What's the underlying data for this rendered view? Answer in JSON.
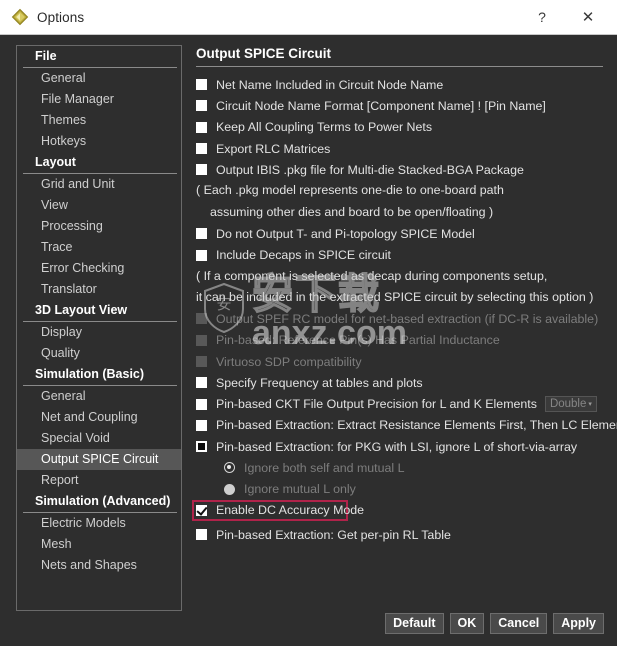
{
  "window": {
    "title": "Options",
    "icon": "diamond-logo-icon",
    "help_label": "?",
    "close_label": "✕"
  },
  "sidebar": {
    "groups": [
      {
        "header": "File",
        "items": [
          "General",
          "File Manager",
          "Themes",
          "Hotkeys"
        ]
      },
      {
        "header": "Layout",
        "items": [
          "Grid and Unit",
          "View",
          "Processing",
          "Trace",
          "Error Checking",
          "Translator"
        ]
      },
      {
        "header": "3D Layout View",
        "items": [
          "Display",
          "Quality"
        ]
      },
      {
        "header": "Simulation (Basic)",
        "items": [
          "General",
          "Net and Coupling",
          "Special Void",
          "Output SPICE Circuit",
          "Report"
        ]
      },
      {
        "header": "Simulation (Advanced)",
        "items": [
          "Electric Models",
          "Mesh",
          "Nets and Shapes"
        ]
      }
    ],
    "selected_item": "Output SPICE Circuit"
  },
  "main": {
    "title": "Output SPICE Circuit",
    "options": [
      {
        "label": "Net Name Included in Circuit Node Name",
        "checked": false,
        "enabled": true
      },
      {
        "label": "Circuit Node Name Format [Component Name] ! [Pin Name]",
        "checked": false,
        "enabled": true
      },
      {
        "label": "Keep All Coupling Terms to Power Nets",
        "checked": false,
        "enabled": true
      },
      {
        "label": "Export RLC Matrices",
        "checked": false,
        "enabled": true
      },
      {
        "label": "Output IBIS .pkg file for Multi-die Stacked-BGA Package",
        "checked": false,
        "enabled": true
      }
    ],
    "note_1_line_1": "( Each .pkg model represents one-die to one-board path",
    "note_1_line_2": "assuming other dies and board to be open/floating )",
    "options_2": [
      {
        "label": "Do not Output T- and Pi-topology SPICE Model",
        "checked": false,
        "enabled": true
      },
      {
        "label": "Include Decaps in SPICE circuit",
        "checked": false,
        "enabled": true
      }
    ],
    "note_2_line_1": "( If a component is selected as decap during components setup,",
    "note_2_line_2": "it can be included in the extracted SPICE circuit by selecting this option )",
    "options_3": [
      {
        "label": "Output SPEF RC model for net-based extraction (if DC-R is available)",
        "checked": false,
        "enabled": false
      },
      {
        "label": "Pin-based: Reference Pin(s) Has Partial Inductance",
        "checked": false,
        "enabled": false
      },
      {
        "label": "Virtuoso SDP compatibility",
        "checked": false,
        "enabled": false
      },
      {
        "label": "Specify Frequency at tables and plots",
        "checked": false,
        "enabled": true
      }
    ],
    "precision_row": {
      "label": "Pin-based CKT File Output Precision for L and K Elements",
      "checked": false,
      "select_value": "Double",
      "caret": "▾"
    },
    "options_4": [
      {
        "label": "Pin-based Extraction: Extract Resistance Elements First, Then LC Elements",
        "checked": false,
        "enabled": true
      }
    ],
    "pkg_lsi_row": {
      "label": "Pin-based Extraction: for PKG with LSI, ignore L of short-via-array",
      "checked": false,
      "style": "dark"
    },
    "radios": [
      {
        "label": "Ignore both self and mutual L",
        "selected": true
      },
      {
        "label": "Ignore mutual L only",
        "selected": false
      }
    ],
    "dc_accuracy_row": {
      "label": "Enable DC Accuracy Mode",
      "checked": true,
      "highlight_color": "#b0234a"
    },
    "options_5": [
      {
        "label": "Pin-based Extraction: Get per-pin RL Table",
        "checked": false,
        "enabled": true
      }
    ]
  },
  "buttons": [
    {
      "label": "Default"
    },
    {
      "label": "OK"
    },
    {
      "label": "Cancel"
    },
    {
      "label": "Apply"
    }
  ],
  "watermark": {
    "chinese": "安下载",
    "latin": "anxz.com"
  },
  "colors": {
    "window_bg": "#2e2e2e",
    "titlebar_bg": "#ffffff",
    "selection_bg": "#575757",
    "highlight": "#b0234a",
    "accent_icon": "#b9a938"
  }
}
